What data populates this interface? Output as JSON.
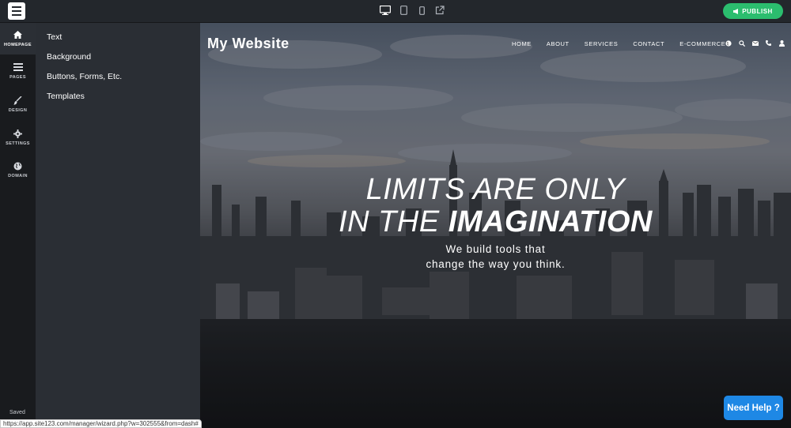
{
  "toolbar": {
    "devices": [
      "desktop-icon",
      "tablet-icon",
      "mobile-icon",
      "external-link-icon"
    ],
    "publish_label": "PUBLISH",
    "publish_color": "#2bbd6e"
  },
  "rail": {
    "items": [
      {
        "label": "HOMEPAGE",
        "icon": "home-icon"
      },
      {
        "label": "PAGES",
        "icon": "pages-icon"
      },
      {
        "label": "DESIGN",
        "icon": "brush-icon"
      },
      {
        "label": "SETTINGS",
        "icon": "gear-icon"
      },
      {
        "label": "DOMAIN",
        "icon": "globe-icon"
      }
    ],
    "saved_label": "Saved"
  },
  "panel": {
    "items": [
      "Text",
      "Background",
      "Buttons, Forms, Etc.",
      "Templates"
    ]
  },
  "site": {
    "title": "My Website",
    "nav": [
      "HOME",
      "ABOUT",
      "SERVICES",
      "CONTACT",
      "E-COMMERCE"
    ],
    "icons": [
      "globe-icon",
      "search-icon",
      "envelope-icon",
      "phone-icon",
      "user-icon"
    ],
    "hero_line1": "LIMITS ARE ONLY",
    "hero_line2_prefix": "IN THE ",
    "hero_line2_bold": "IMAGINATION",
    "hero_sub1": "We build tools that",
    "hero_sub2": "change the way you think."
  },
  "help": {
    "label": "Need Help ?",
    "color": "#1e88e5"
  },
  "status_url": "https://app.site123.com/manager/wizard.php?w=302555&from=dash#"
}
